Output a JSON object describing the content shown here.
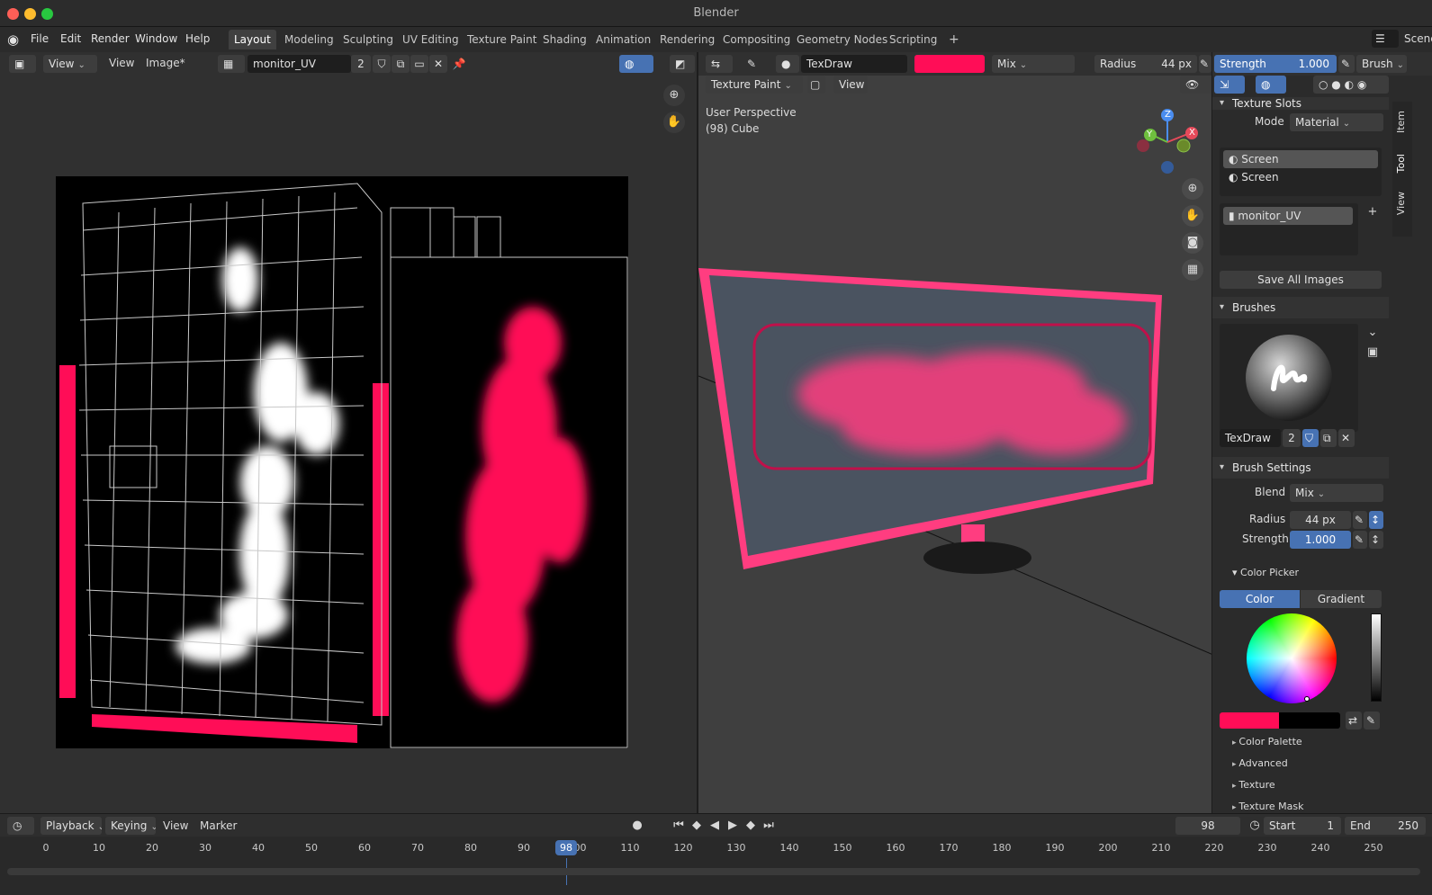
{
  "window": {
    "title": "Blender"
  },
  "menu": [
    "File",
    "Edit",
    "Render",
    "Window",
    "Help"
  ],
  "workspaces": [
    "Layout",
    "Modeling",
    "Sculpting",
    "UV Editing",
    "Texture Paint",
    "Shading",
    "Animation",
    "Rendering",
    "Compositing",
    "Geometry Nodes",
    "Scripting"
  ],
  "active_workspace": "Layout",
  "scene_label": "Scene",
  "image_editor": {
    "menus": [
      "View",
      "View",
      "Image*"
    ],
    "image_name": "monitor_UV",
    "users": "2"
  },
  "tool_header": {
    "brush_name": "TexDraw",
    "color_hex": "#ff0d57",
    "blend": "Mix",
    "radius_label": "Radius",
    "radius_value": "44 px",
    "strength_label": "Strength",
    "strength_value": "1.000",
    "brush_menu": "Brush"
  },
  "viewport": {
    "mode": "Texture Paint",
    "view_menu": "View",
    "overlay_line1": "User Perspective",
    "overlay_line2": "(98) Cube",
    "gizmo_z": "Z",
    "gizmo_y": "Y",
    "gizmo_x": "X"
  },
  "sidebar": {
    "tabs": [
      "Item",
      "Tool",
      "View"
    ],
    "texture_slots": {
      "header": "Texture Slots",
      "mode_label": "Mode",
      "mode_value": "Material",
      "slots": [
        "Screen",
        "Screen"
      ],
      "image": "monitor_UV",
      "save_all": "Save All Images"
    },
    "brushes": {
      "header": "Brushes",
      "name": "TexDraw",
      "users": "2"
    },
    "brush_settings": {
      "header": "Brush Settings",
      "blend_label": "Blend",
      "blend_value": "Mix",
      "radius_label": "Radius",
      "radius_value": "44 px",
      "strength_label": "Strength",
      "strength_value": "1.000",
      "color_picker": "Color Picker",
      "color_tab": "Color",
      "gradient_tab": "Gradient",
      "collapsed": [
        "Color Palette",
        "Advanced",
        "Texture",
        "Texture Mask"
      ]
    }
  },
  "timeline": {
    "menus": [
      "Playback",
      "Keying",
      "View",
      "Marker"
    ],
    "current_frame": "98",
    "start_label": "Start",
    "start": "1",
    "end_label": "End",
    "end": "250",
    "ticks": [
      "0",
      "10",
      "20",
      "30",
      "40",
      "50",
      "60",
      "70",
      "80",
      "90",
      "100",
      "110",
      "120",
      "130",
      "140",
      "150",
      "160",
      "170",
      "180",
      "190",
      "200",
      "210",
      "220",
      "230",
      "240",
      "250"
    ],
    "playhead": "98"
  },
  "colors": {
    "paint": "#ff0d57",
    "accent": "#4772b3",
    "panel": "#2b2b2b"
  }
}
